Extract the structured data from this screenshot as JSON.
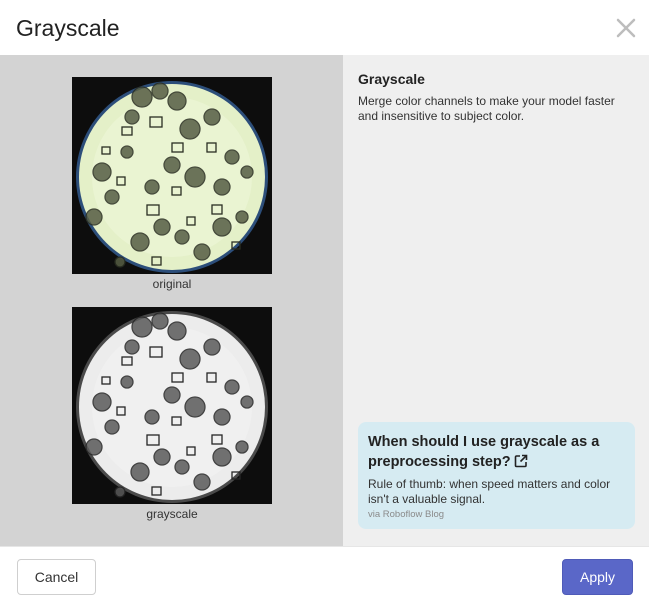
{
  "dialog": {
    "title": "Grayscale",
    "close_icon": "close-icon"
  },
  "preview": {
    "original_caption": "original",
    "grayscale_caption": "grayscale"
  },
  "info": {
    "title": "Grayscale",
    "description": "Merge color channels to make your model faster and insensitive to subject color."
  },
  "tip": {
    "title": "When should I use grayscale as a preprocessing step?",
    "link_icon": "external-link-icon",
    "text": "Rule of thumb: when speed matters and color isn't a valuable signal.",
    "source": "via Roboflow Blog"
  },
  "footer": {
    "cancel_label": "Cancel",
    "apply_label": "Apply"
  },
  "colors": {
    "apply_button": "#5a67c8",
    "tip_background": "#d6ebf2",
    "left_pane": "#d3d3d3",
    "right_pane": "#efefef"
  }
}
